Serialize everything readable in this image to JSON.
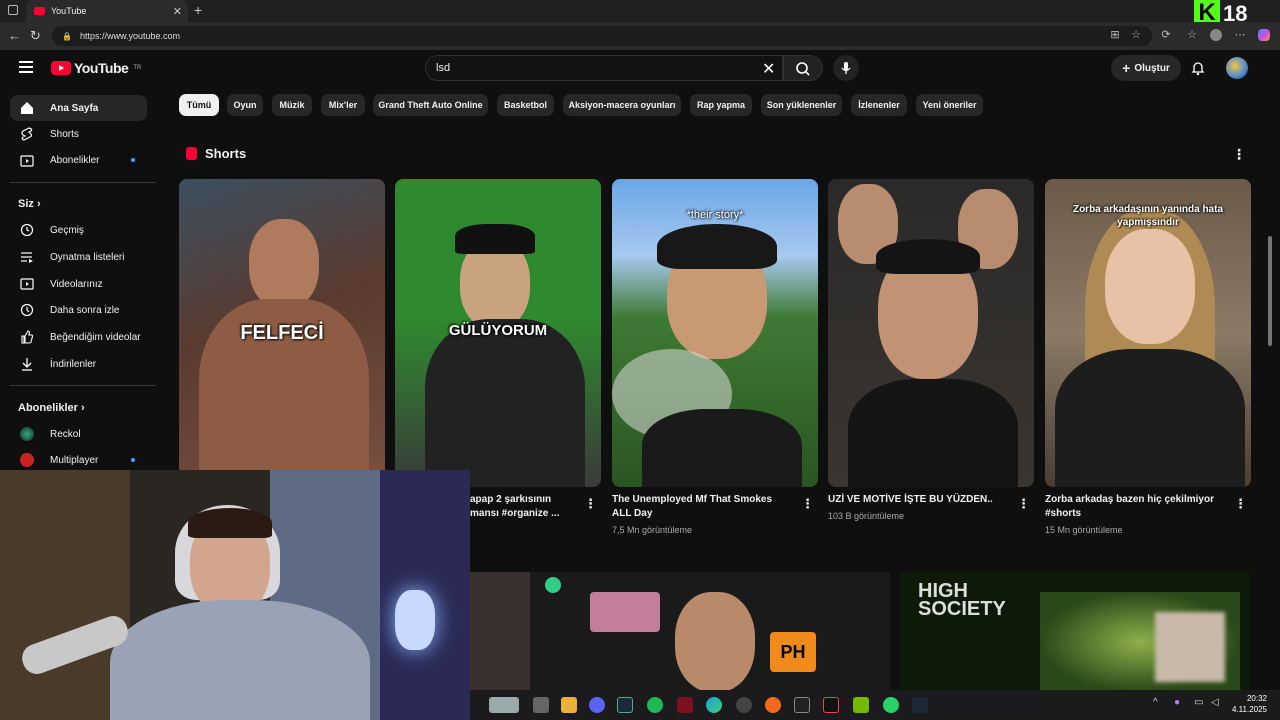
{
  "browser": {
    "tab_title": "YouTube",
    "url": "https://www.youtube.com",
    "brand_letter": "K",
    "brand_number": "18"
  },
  "youtube": {
    "logo_text": "YouTube",
    "logo_sup": "TR",
    "search_value": "lsd",
    "create_label": "Oluştur"
  },
  "sidebar": {
    "main": [
      {
        "label": "Ana Sayfa",
        "icon": "home-icon"
      },
      {
        "label": "Shorts",
        "icon": "shorts-icon"
      },
      {
        "label": "Abonelikler",
        "icon": "subscriptions-icon"
      }
    ],
    "you_title": "Siz",
    "you_items": [
      {
        "label": "Geçmiş",
        "icon": "history-icon"
      },
      {
        "label": "Oynatma listeleri",
        "icon": "playlist-icon"
      },
      {
        "label": "Videolarınız",
        "icon": "your-videos-icon"
      },
      {
        "label": "Daha sonra izle",
        "icon": "clock-icon"
      },
      {
        "label": "Beğendiğim videolar",
        "icon": "like-icon"
      },
      {
        "label": "İndirilenler",
        "icon": "download-icon"
      }
    ],
    "subs_title": "Abonelikler",
    "subs": [
      {
        "label": "Reckol"
      },
      {
        "label": "Multiplayer"
      }
    ]
  },
  "chips": [
    "Tümü",
    "Oyun",
    "Müzik",
    "Mix'ler",
    "Grand Theft Auto Online",
    "Basketbol",
    "Aksiyon-macera oyunları",
    "Rap yapma",
    "Son yüklenenler",
    "İzlenenler",
    "Yeni öneriler"
  ],
  "shorts": {
    "section_title": "Shorts",
    "items": [
      {
        "overlay": "FELFECİ",
        "title": "",
        "views": ""
      },
      {
        "overlay": "GÜLÜYORUM",
        "title": "apap 2 şarkısının mansı #organize ...",
        "views": ""
      },
      {
        "overlay": "*their story*",
        "title": "The Unemployed Mf That Smokes ALL Day",
        "views": "7,5 Mn görüntüleme"
      },
      {
        "overlay": "",
        "title": "UZİ VE MOTİVE İŞTE BU YÜZDEN..",
        "views": "103 B görüntüleme"
      },
      {
        "overlay": "Zorba arkadaşının yanında hata yapmışsındır",
        "title": "Zorba arkadaş bazen hiç çekilmiyor #shorts",
        "views": "15 Mn görüntüleme"
      }
    ]
  },
  "lower": {
    "vid3_text": "HIGH SOCIETY",
    "vid2_badge": "PH"
  },
  "taskbar": {
    "time": "20:32",
    "date": "4.11.2025"
  }
}
